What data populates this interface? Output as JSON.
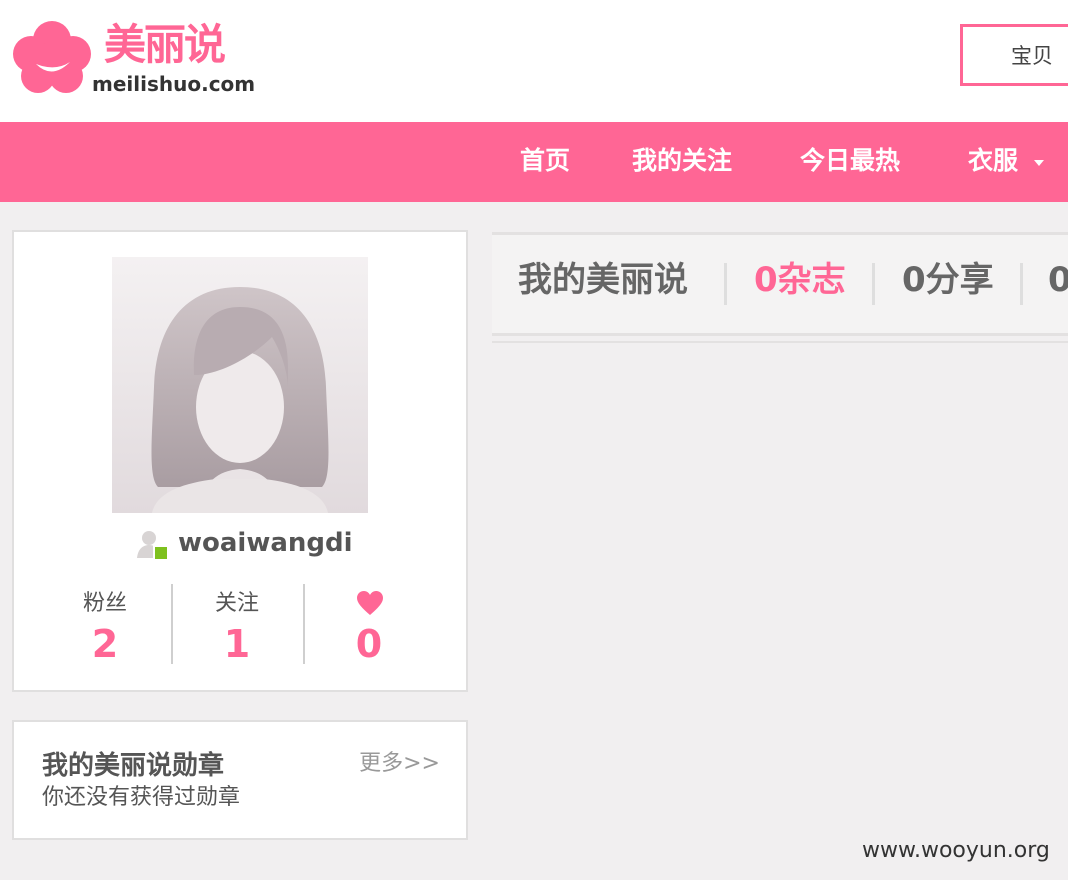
{
  "logo": {
    "cn": "美丽说",
    "en": "meilishuo.com"
  },
  "search": {
    "category": "宝贝"
  },
  "nav": {
    "items": [
      "首页",
      "我的关注",
      "今日最热",
      "衣服"
    ]
  },
  "profile": {
    "username": "woaiwangdi",
    "stats": [
      {
        "label": "粉丝",
        "value": "2"
      },
      {
        "label": "关注",
        "value": "1"
      },
      {
        "icon": "heart-icon",
        "value": "0"
      }
    ]
  },
  "badges": {
    "title": "我的美丽说勋章",
    "more": "更多>>",
    "empty": "你还没有获得过勋章"
  },
  "tabs": {
    "items": [
      "我的美丽说",
      "0杂志",
      "0分享",
      "0"
    ]
  },
  "watermark": "www.wooyun.org",
  "colors": {
    "brand": "#ff6695",
    "background": "#f1eff0"
  }
}
